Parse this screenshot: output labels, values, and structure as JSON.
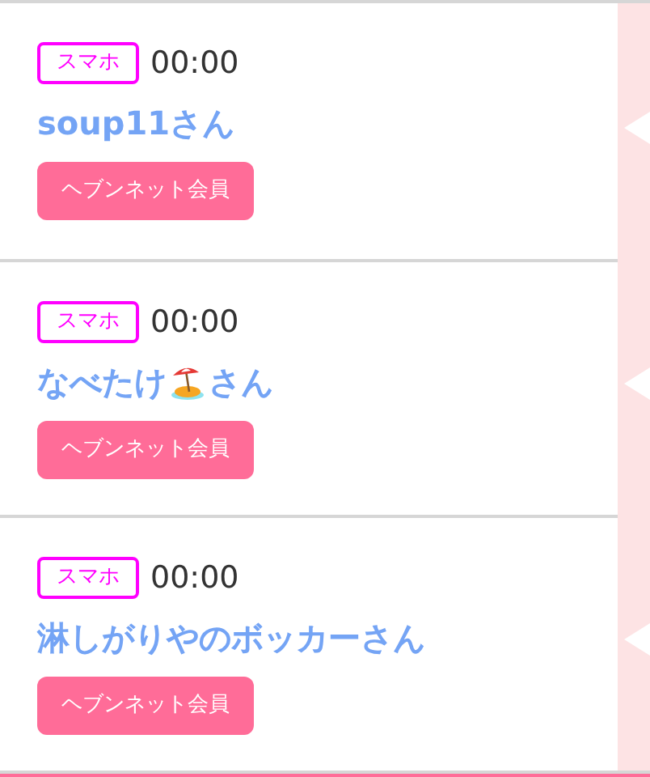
{
  "entries": [
    {
      "device": "スマホ",
      "time": "00:00",
      "name_parts": [
        {
          "kind": "text",
          "text": "soup11さん"
        }
      ],
      "badge": "ヘブンネット会員"
    },
    {
      "device": "スマホ",
      "time": "00:00",
      "name_parts": [
        {
          "kind": "text",
          "text": "なべたけ"
        },
        {
          "kind": "icon"
        },
        {
          "kind": "text",
          "text": "さん"
        }
      ],
      "badge": "ヘブンネット会員"
    },
    {
      "device": "スマホ",
      "time": "00:00",
      "name_parts": [
        {
          "kind": "text",
          "text": "淋しがりやのボッカーさん"
        }
      ],
      "badge": "ヘブンネット会員"
    }
  ]
}
